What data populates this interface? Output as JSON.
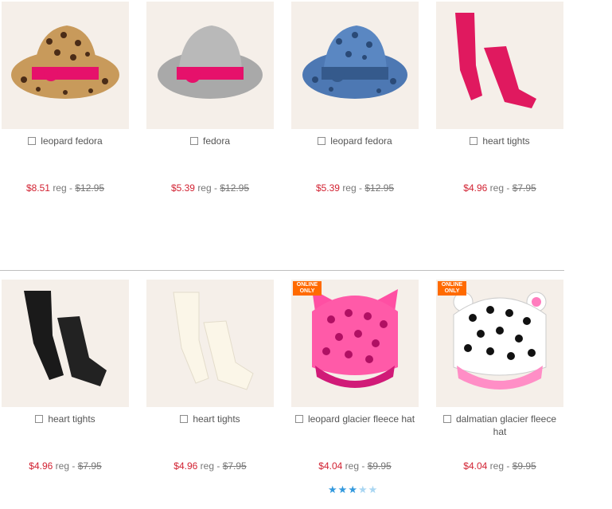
{
  "products": [
    {
      "name": "leopard fedora",
      "sale": "$8.51",
      "reg_label": "reg -",
      "reg": "$12.95",
      "badge": "",
      "icon": "leopard-fedora-image"
    },
    {
      "name": "fedora",
      "sale": "$5.39",
      "reg_label": "reg -",
      "reg": "$12.95",
      "badge": "",
      "icon": "gray-fedora-image"
    },
    {
      "name": "leopard fedora",
      "sale": "$5.39",
      "reg_label": "reg -",
      "reg": "$12.95",
      "badge": "",
      "icon": "blue-leopard-fedora-image"
    },
    {
      "name": "heart tights",
      "sale": "$4.96",
      "reg_label": "reg -",
      "reg": "$7.95",
      "badge": "",
      "icon": "pink-tights-image"
    },
    {
      "name": "heart tights",
      "sale": "$4.96",
      "reg_label": "reg -",
      "reg": "$7.95",
      "badge": "",
      "icon": "black-tights-image"
    },
    {
      "name": "heart tights",
      "sale": "$4.96",
      "reg_label": "reg -",
      "reg": "$7.95",
      "badge": "",
      "icon": "white-tights-image"
    },
    {
      "name": "leopard glacier fleece hat",
      "sale": "$4.04",
      "reg_label": "reg -",
      "reg": "$9.95",
      "badge": "ONLINE ONLY",
      "icon": "pink-leopard-hat-image"
    },
    {
      "name": "dalmatian glacier fleece hat",
      "sale": "$4.04",
      "reg_label": "reg -",
      "reg": "$9.95",
      "badge": "ONLINE ONLY",
      "icon": "dalmatian-hat-image"
    }
  ],
  "rating": {
    "value": 3,
    "max": 5,
    "filled_color": "#3399dd",
    "empty_color": "#a9d6f2"
  },
  "colors": {
    "sale": "#d22232",
    "badge": "#ff6a00"
  }
}
